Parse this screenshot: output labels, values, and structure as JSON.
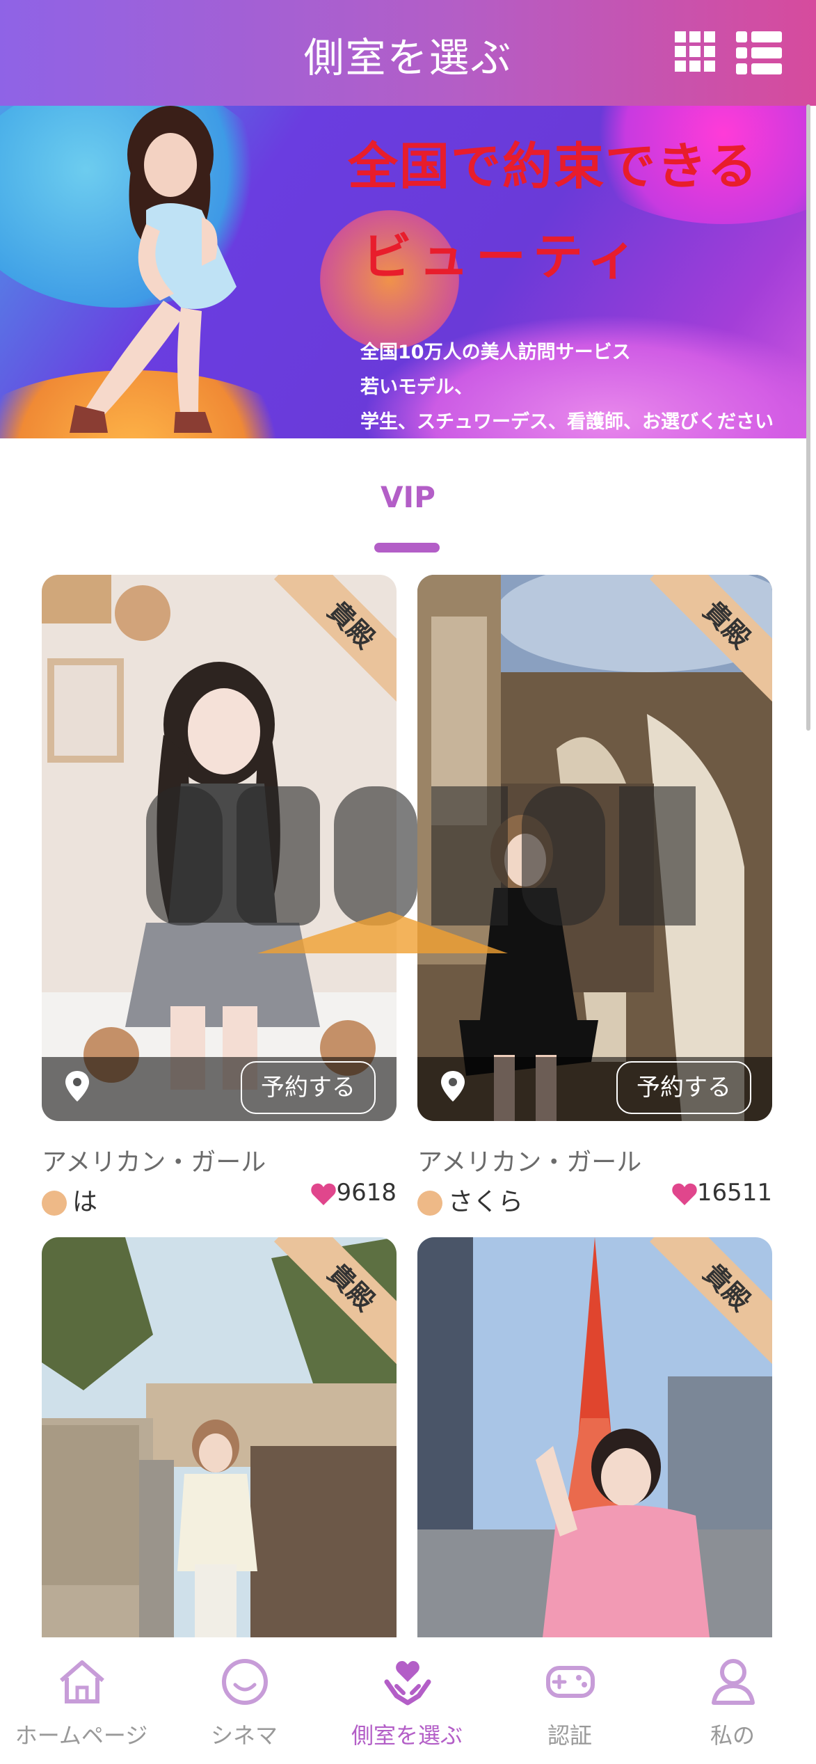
{
  "header": {
    "title": "側室を選ぶ",
    "grid_view_icon": "grid-icon",
    "list_view_icon": "list-icon"
  },
  "banner": {
    "headline1": "全国で約束できる",
    "headline2": "ビューティ",
    "line1": "全国10万人の美人訪問サービス",
    "line2": "若いモデル、",
    "line3": "学生、スチュワーデス、看護師、お選びください"
  },
  "tabs": {
    "active": "VIP"
  },
  "cards": [
    {
      "ribbon": "貴殿",
      "book_label": "予約する",
      "title": "アメリカン・ガール",
      "user": "は",
      "likes": "9618"
    },
    {
      "ribbon": "貴殿",
      "book_label": "予約する",
      "title": "アメリカン・ガール",
      "user": "さくら",
      "likes": "16511"
    },
    {
      "ribbon": "貴殿"
    },
    {
      "ribbon": "貴殿"
    }
  ],
  "bottom_nav": [
    {
      "label": "ホームページ",
      "icon": "home-icon"
    },
    {
      "label": "シネマ",
      "icon": "smile-icon"
    },
    {
      "label": "側室を選ぶ",
      "icon": "heart-hands-icon",
      "active": true
    },
    {
      "label": "認証",
      "icon": "gamepad-icon"
    },
    {
      "label": "私の",
      "icon": "user-icon"
    }
  ],
  "colors": {
    "accent": "#b35ec7",
    "header_start": "#8f63e6",
    "header_end": "#d64b9d",
    "ribbon": "#eac39b",
    "heart": "#e0468c"
  }
}
